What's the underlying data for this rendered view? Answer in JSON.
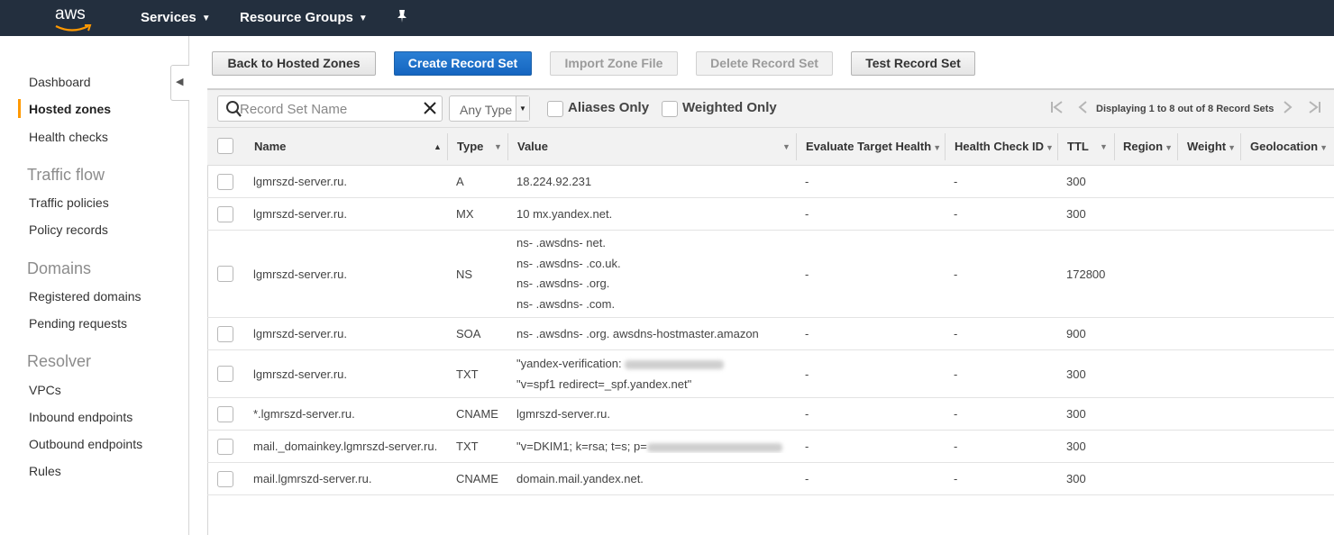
{
  "topnav": {
    "logo": "aws",
    "services": "Services",
    "resource_groups": "Resource Groups",
    "pin_icon": "pushpin-icon"
  },
  "sidebar": {
    "items": [
      {
        "label": "Dashboard"
      },
      {
        "label": "Hosted zones",
        "active": true
      },
      {
        "label": "Health checks"
      }
    ],
    "sections": [
      {
        "heading": "Traffic flow",
        "items": [
          "Traffic policies",
          "Policy records"
        ]
      },
      {
        "heading": "Domains",
        "items": [
          "Registered domains",
          "Pending requests"
        ]
      },
      {
        "heading": "Resolver",
        "items": [
          "VPCs",
          "Inbound endpoints",
          "Outbound endpoints",
          "Rules"
        ]
      }
    ]
  },
  "toolbar": {
    "back": "Back to Hosted Zones",
    "create": "Create Record Set",
    "import": "Import Zone File",
    "delete": "Delete Record Set",
    "test": "Test Record Set"
  },
  "filters": {
    "search_placeholder": "Record Set Name",
    "type_select": "Any Type",
    "aliases_only": "Aliases Only",
    "weighted_only": "Weighted Only",
    "pager_text": "Displaying 1 to 8 out of 8 Record Sets"
  },
  "table": {
    "columns": [
      "Name",
      "Type",
      "Value",
      "Evaluate Target Health",
      "Health Check ID",
      "TTL",
      "Region",
      "Weight",
      "Geolocation"
    ],
    "rows": [
      {
        "name": "lgmrszd-server.ru.",
        "type": "A",
        "value": [
          "18.224.92.231"
        ],
        "eval": "-",
        "hc": "-",
        "ttl": "300"
      },
      {
        "name": "lgmrszd-server.ru.",
        "type": "MX",
        "value": [
          "10 mx.yandex.net."
        ],
        "eval": "-",
        "hc": "-",
        "ttl": "300"
      },
      {
        "name": "lgmrszd-server.ru.",
        "type": "NS",
        "value": [
          "ns-     .awsdns-    net.",
          "ns-     .awsdns-    .co.uk.",
          "ns-     .awsdns-    .org.",
          "ns-     .awsdns-    .com."
        ],
        "eval": "-",
        "hc": "-",
        "ttl": "172800"
      },
      {
        "name": "lgmrszd-server.ru.",
        "type": "SOA",
        "value": [
          "ns-     .awsdns-    .org. awsdns-hostmaster.amazon"
        ],
        "eval": "-",
        "hc": "-",
        "ttl": "900"
      },
      {
        "name": "lgmrszd-server.ru.",
        "type": "TXT",
        "value": [
          "\"yandex-verification: ",
          "\"v=spf1 redirect=_spf.yandex.net\""
        ],
        "eval": "-",
        "hc": "-",
        "ttl": "300"
      },
      {
        "name": "*.lgmrszd-server.ru.",
        "type": "CNAME",
        "value": [
          "lgmrszd-server.ru."
        ],
        "eval": "-",
        "hc": "-",
        "ttl": "300"
      },
      {
        "name": "mail._domainkey.lgmrszd-server.ru.",
        "type": "TXT",
        "value": [
          "\"v=DKIM1; k=rsa; t=s; p="
        ],
        "eval": "-",
        "hc": "-",
        "ttl": "300"
      },
      {
        "name": "mail.lgmrszd-server.ru.",
        "type": "CNAME",
        "value": [
          "domain.mail.yandex.net."
        ],
        "eval": "-",
        "hc": "-",
        "ttl": "300"
      }
    ]
  }
}
